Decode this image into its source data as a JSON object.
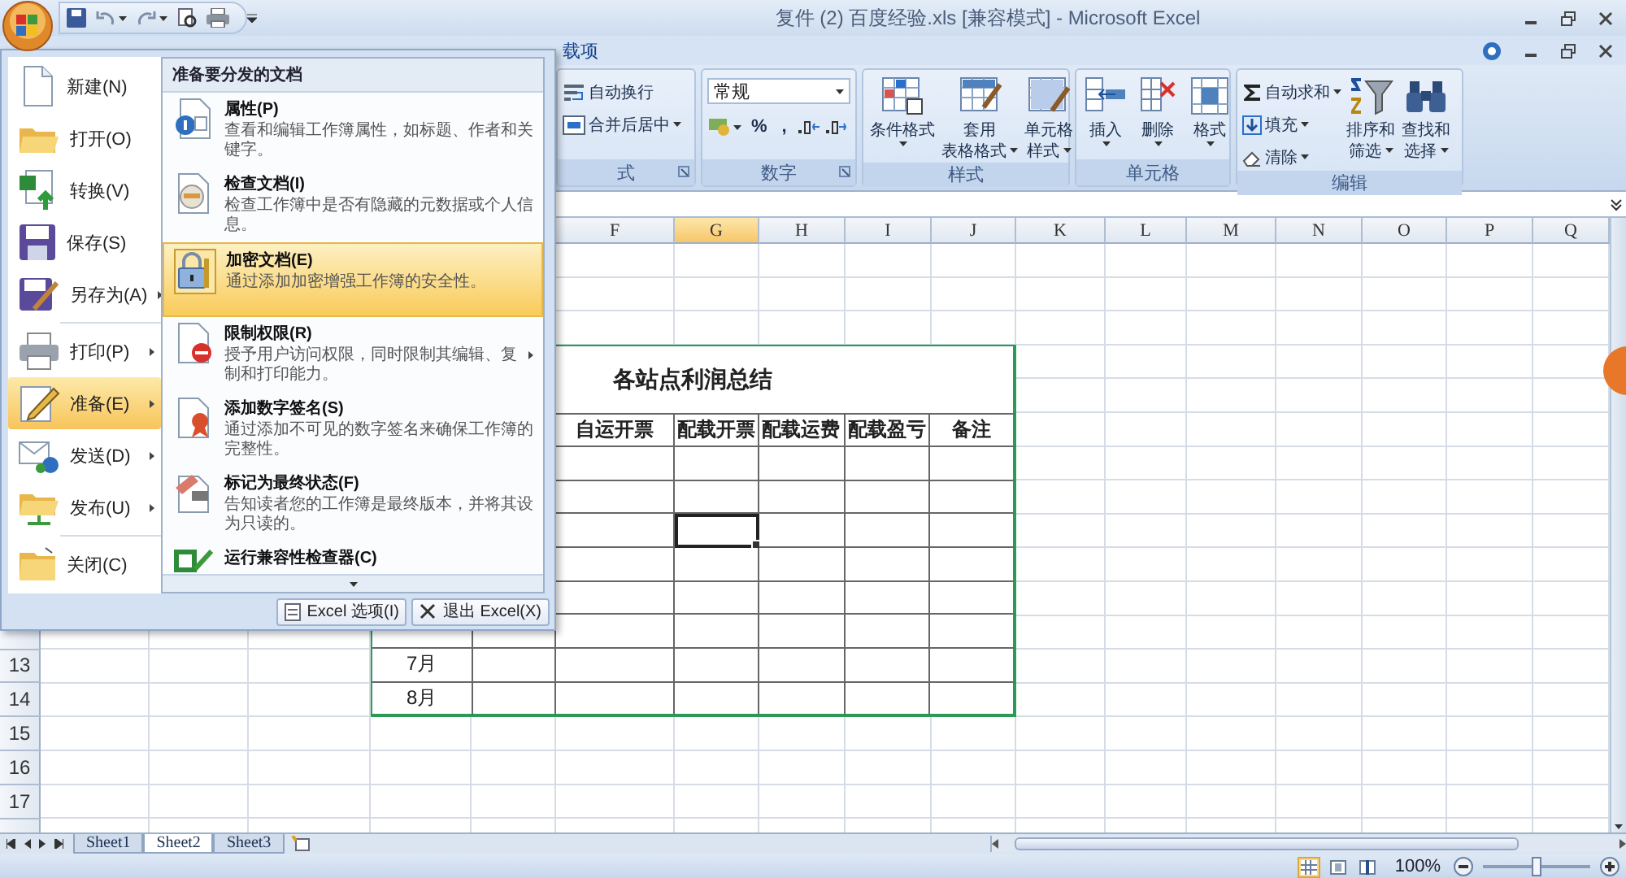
{
  "window": {
    "title": "复件 (2) 百度经验.xls [兼容模式] - Microsoft Excel"
  },
  "ribbon_tabs": [
    {
      "label": "载项",
      "selected": false
    }
  ],
  "ribbon_groups": [
    {
      "label": "式",
      "launcher": true,
      "small_buttons": [
        {
          "label": "自动换行",
          "dropdown": false
        },
        {
          "label": "合并后居中",
          "dropdown": true
        }
      ]
    },
    {
      "label": "数字",
      "launcher": true,
      "format_box": {
        "value": "常规"
      },
      "symbols": [
        "%",
        ","
      ]
    },
    {
      "label": "样式",
      "launcher": false,
      "large_buttons": [
        {
          "lines": [
            "条件格式"
          ],
          "dropdown": true
        },
        {
          "lines": [
            "套用",
            "表格格式"
          ],
          "dropdown": true
        },
        {
          "lines": [
            "单元格",
            "样式"
          ],
          "dropdown": true
        }
      ]
    },
    {
      "label": "单元格",
      "launcher": false,
      "large_buttons": [
        {
          "lines": [
            "插入"
          ],
          "dropdown": true
        },
        {
          "lines": [
            "删除"
          ],
          "dropdown": true
        },
        {
          "lines": [
            "格式"
          ],
          "dropdown": true
        }
      ]
    },
    {
      "label": "编辑",
      "launcher": false,
      "small_buttons": [
        {
          "label": "自动求和",
          "dropdown": true
        },
        {
          "label": "填充",
          "dropdown": true
        },
        {
          "label": "清除",
          "dropdown": true
        }
      ],
      "large_buttons": [
        {
          "lines": [
            "排序和",
            "筛选"
          ],
          "dropdown": true
        },
        {
          "lines": [
            "查找和",
            "选择"
          ],
          "dropdown": true
        }
      ]
    }
  ],
  "sheet": {
    "column_headers": [
      {
        "label": "F",
        "selected": false
      },
      {
        "label": "G",
        "selected": true
      },
      {
        "label": "H",
        "selected": false
      },
      {
        "label": "I",
        "selected": false
      },
      {
        "label": "J",
        "selected": false
      },
      {
        "label": "K",
        "selected": false
      },
      {
        "label": "L",
        "selected": false
      },
      {
        "label": "M",
        "selected": false
      },
      {
        "label": "N",
        "selected": false
      },
      {
        "label": "O",
        "selected": false
      },
      {
        "label": "P",
        "selected": false
      },
      {
        "label": "Q",
        "selected": false
      }
    ],
    "row_headers": [
      "13",
      "14",
      "15",
      "16",
      "17"
    ],
    "table": {
      "title": "各站点利润总结",
      "columns": [
        "自运开票",
        "配载开票",
        "配载运费",
        "配载盈亏",
        "备注"
      ],
      "rows": [
        {
          "cells": [
            {
              "selected": false
            },
            {
              "selected": false
            },
            {
              "selected": false
            },
            {
              "selected": false
            },
            {
              "selected": false
            }
          ]
        },
        {
          "cells": [
            {
              "selected": false
            },
            {
              "selected": false
            },
            {
              "selected": false
            },
            {
              "selected": false
            },
            {
              "selected": false
            }
          ]
        },
        {
          "cells": [
            {
              "selected": false
            },
            {
              "selected": true
            },
            {
              "selected": false
            },
            {
              "selected": false
            },
            {
              "selected": false
            }
          ]
        },
        {
          "cells": [
            {
              "selected": false
            },
            {
              "selected": false
            },
            {
              "selected": false
            },
            {
              "selected": false
            },
            {
              "selected": false
            }
          ]
        },
        {
          "cells": [
            {
              "selected": false
            },
            {
              "selected": false
            },
            {
              "selected": false
            },
            {
              "selected": false
            },
            {
              "selected": false
            }
          ]
        },
        {
          "cells": [
            {
              "selected": false
            },
            {
              "selected": false
            },
            {
              "selected": false
            },
            {
              "selected": false
            },
            {
              "selected": false
            }
          ]
        },
        {
          "month": "7月",
          "cells": [
            {
              "selected": false
            },
            {
              "selected": false
            },
            {
              "selected": false
            },
            {
              "selected": false
            },
            {
              "selected": false
            }
          ]
        },
        {
          "month": "8月",
          "cells": [
            {
              "selected": false
            },
            {
              "selected": false
            },
            {
              "selected": false
            },
            {
              "selected": false
            },
            {
              "selected": false
            }
          ]
        }
      ]
    }
  },
  "sheet_tabs": [
    {
      "label": "Sheet1",
      "selected": false
    },
    {
      "label": "Sheet2",
      "selected": true
    },
    {
      "label": "Sheet3",
      "selected": false
    }
  ],
  "status_bar": {
    "views": [
      {
        "selected": true
      },
      {
        "selected": false
      },
      {
        "selected": false
      }
    ],
    "zoom": {
      "label": "100%",
      "level": 0.5
    }
  },
  "office_menu": {
    "items": [
      {
        "label": "新建(N)",
        "submenu": false,
        "selected": false
      },
      {
        "label": "打开(O)",
        "submenu": false,
        "selected": false
      },
      {
        "label": "转换(V)",
        "submenu": false,
        "selected": false
      },
      {
        "label": "保存(S)",
        "submenu": false,
        "selected": false
      },
      {
        "label": "另存为(A)",
        "submenu": true,
        "selected": false
      },
      {
        "label": "打印(P)",
        "submenu": true,
        "selected": false
      },
      {
        "label": "准备(E)",
        "submenu": true,
        "selected": true
      },
      {
        "label": "发送(D)",
        "submenu": true,
        "selected": false
      },
      {
        "label": "发布(U)",
        "submenu": true,
        "selected": false
      },
      {
        "label": "关闭(C)",
        "submenu": false,
        "selected": false
      }
    ],
    "panel": {
      "title": "准备要分发的文档",
      "items": [
        {
          "title": "属性(P)",
          "description": "查看和编辑工作簿属性，如标题、作者和关键字。",
          "submenu": false,
          "selected": false
        },
        {
          "title": "检查文档(I)",
          "description": "检查工作簿中是否有隐藏的元数据或个人信息。",
          "submenu": false,
          "selected": false
        },
        {
          "title": "加密文档(E)",
          "description": "通过添加加密增强工作簿的安全性。",
          "submenu": false,
          "selected": true
        },
        {
          "title": "限制权限(R)",
          "description": "授予用户访问权限，同时限制其编辑、复制和打印能力。",
          "submenu": true,
          "selected": false
        },
        {
          "title": "添加数字签名(S)",
          "description": "通过添加不可见的数字签名来确保工作簿的完整性。",
          "submenu": false,
          "selected": false
        },
        {
          "title": "标记为最终状态(F)",
          "description": "告知读者您的工作簿是最终版本，并将其设为只读的。",
          "submenu": false,
          "selected": false
        },
        {
          "title": "运行兼容性检查器(C)",
          "submenu": false,
          "selected": false
        }
      ]
    },
    "buttons": [
      {
        "label": "Excel 选项(I)"
      },
      {
        "label": "退出 Excel(X)"
      }
    ]
  }
}
